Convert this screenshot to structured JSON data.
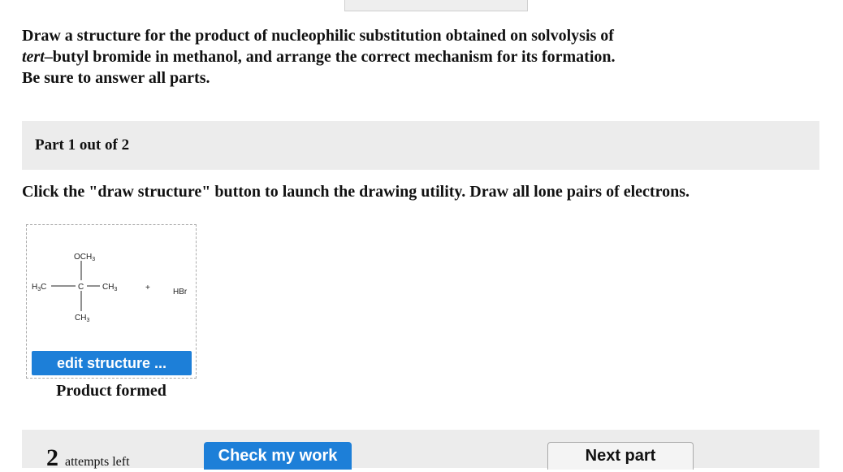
{
  "question": {
    "line1": "Draw a structure for the product of nucleophilic substitution obtained on solvolysis of",
    "line2_italic": "tert",
    "line2_rest": "–butyl bromide in methanol, and arrange the correct mechanism for its formation.",
    "line3": "Be sure to answer all parts."
  },
  "part": {
    "label": "Part 1 out of 2"
  },
  "instruction": "Click the \"draw structure\" button to launch the drawing utility. Draw all lone pairs of electrons.",
  "structure": {
    "top_group": {
      "main": "OCH",
      "sub": "3"
    },
    "left_group": {
      "main": "H",
      "sub": "3",
      "tail": "C"
    },
    "center_atom": "C",
    "right_group": {
      "main": "CH",
      "sub": "3"
    },
    "bottom_group": {
      "main": "CH",
      "sub": "3"
    },
    "plus": "+",
    "byproduct": "HBr"
  },
  "edit_button_label": "edit structure ...",
  "caption": "Product formed",
  "footer": {
    "attempts_count": "2",
    "attempts_text": "attempts left",
    "check_label": "Check my work",
    "next_label": "Next part"
  },
  "colors": {
    "button_blue": "#1d7fd8",
    "panel_gray": "#ececec"
  }
}
